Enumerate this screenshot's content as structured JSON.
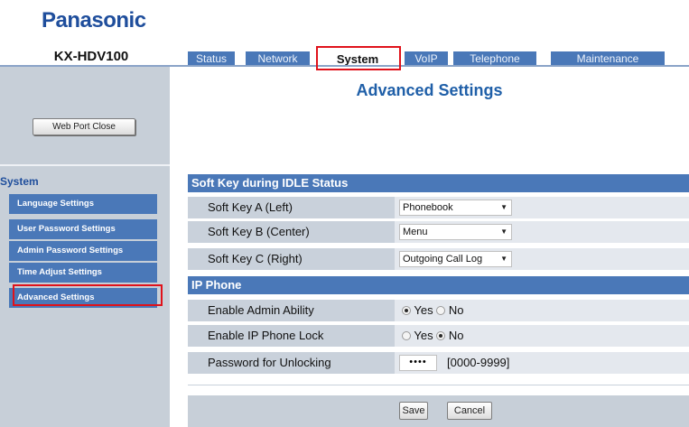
{
  "brand": {
    "logo": "Panasonic",
    "model": "KX-HDV100"
  },
  "tabs": [
    {
      "label": "Status"
    },
    {
      "label": "Network"
    },
    {
      "label": "System"
    },
    {
      "label": "VoIP"
    },
    {
      "label": "Telephone"
    },
    {
      "label": "Maintenance"
    }
  ],
  "active_tab": "System",
  "sidebar": {
    "web_port_button": "Web Port Close",
    "section_title": "System",
    "items": [
      {
        "label": "Language Settings"
      },
      {
        "label": "User Password Settings"
      },
      {
        "label": "Admin Password Settings"
      },
      {
        "label": "Time Adjust Settings"
      },
      {
        "label": "Advanced Settings"
      }
    ],
    "selected": "Advanced Settings"
  },
  "main": {
    "title": "Advanced Settings",
    "sections": [
      {
        "heading": "Soft Key during IDLE Status",
        "rows": [
          {
            "label": "Soft Key A (Left)",
            "value": "Phonebook"
          },
          {
            "label": "Soft Key B (Center)",
            "value": "Menu"
          },
          {
            "label": "Soft Key C (Right)",
            "value": "Outgoing Call Log"
          }
        ]
      },
      {
        "heading": "IP Phone",
        "rows": [
          {
            "label": "Enable Admin Ability",
            "yes": "Yes",
            "no": "No",
            "selected": "Yes"
          },
          {
            "label": "Enable IP Phone Lock",
            "yes": "Yes",
            "no": "No",
            "selected": "No"
          },
          {
            "label": "Password for Unlocking",
            "value": "••••",
            "hint": "[0000-9999]"
          }
        ]
      }
    ],
    "buttons": {
      "save": "Save",
      "cancel": "Cancel"
    }
  },
  "colors": {
    "accent": "#4a78b8",
    "highlight": "#e0121b",
    "brand": "#1f4e9c"
  },
  "icons": {
    "dropdown": "chevron-down-icon"
  }
}
